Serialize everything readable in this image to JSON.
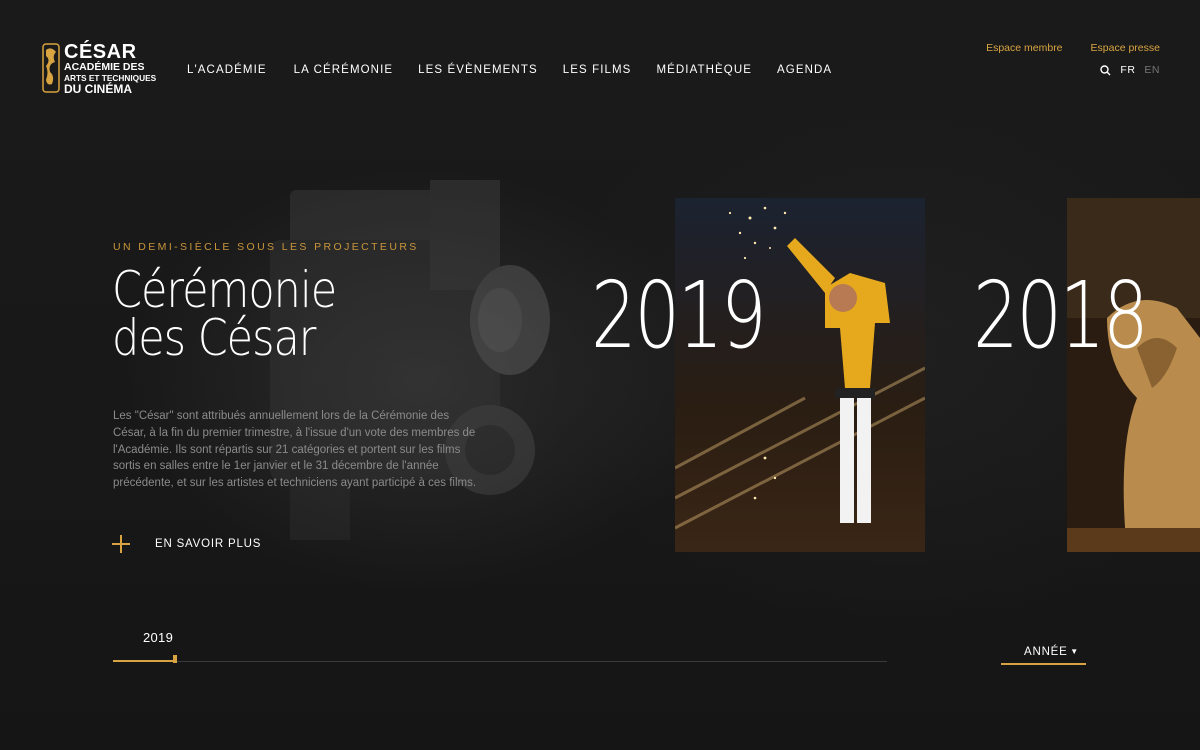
{
  "logo": {
    "main": "CÉSAR",
    "line1": "ACADÉMIE DES",
    "line2": "ARTS ET TECHNIQUES",
    "line3": "DU CINÉMA"
  },
  "nav": [
    {
      "label": "L'ACADÉMIE"
    },
    {
      "label": "LA CÉRÉMONIE"
    },
    {
      "label": "LES ÉVÈNEMENTS"
    },
    {
      "label": "LES FILMS"
    },
    {
      "label": "MÉDIATHÈQUE"
    },
    {
      "label": "AGENDA"
    }
  ],
  "top_links": {
    "member": "Espace membre",
    "press": "Espace presse"
  },
  "language": {
    "active": "FR",
    "other": "EN"
  },
  "hero": {
    "kicker": "UN DEMI-SIÈCLE SOUS LES PROJECTEURS",
    "title_line1": "Cérémonie",
    "title_line2": "des César",
    "description": "Les \"César\" sont attribués annuellement lors de la Cérémonie des César, à la fin du premier trimestre, à l'issue d'un vote des membres de l'Académie. Ils sont répartis sur 21 catégories et portent sur les films sortis en salles entre le 1er janvier et le 31 décembre de l'année précédente, et sur les artistes et techniciens ayant participé à ces films.",
    "more_label": "EN SAVOIR PLUS"
  },
  "editions": [
    {
      "year": "2019"
    },
    {
      "year": "2018"
    }
  ],
  "timeline": {
    "current_year": "2019",
    "progress": 0.08
  },
  "year_select": {
    "label": "ANNÉE"
  },
  "colors": {
    "accent": "#d8a441",
    "background": "#161616",
    "muted_text": "#8b8b8b"
  }
}
